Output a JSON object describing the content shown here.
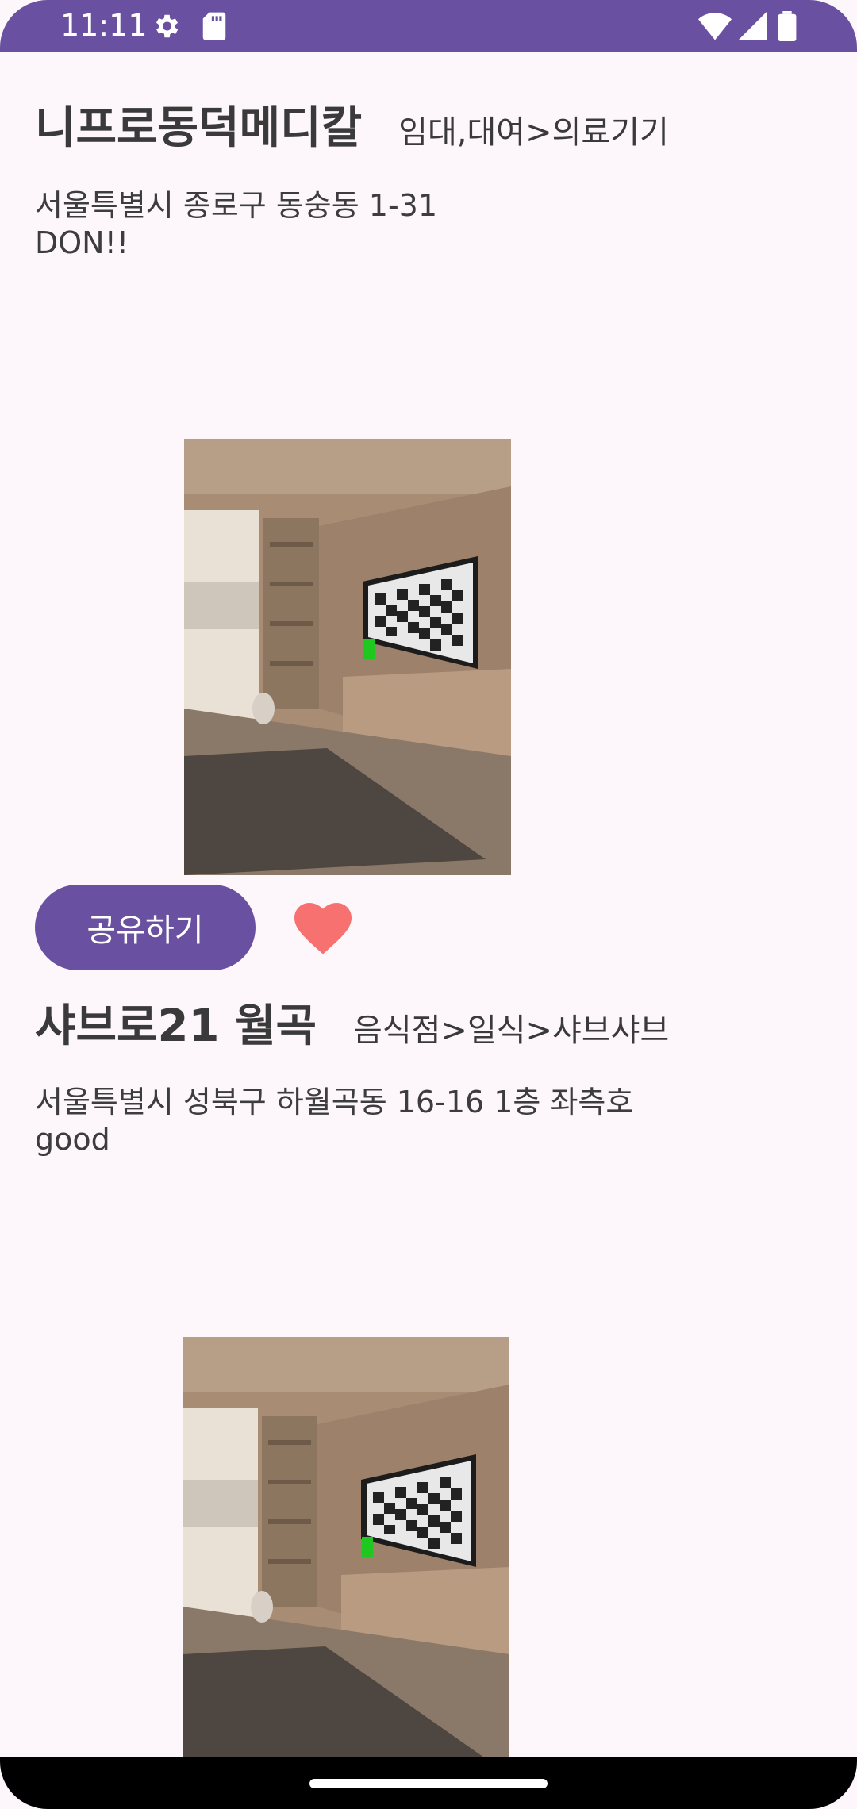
{
  "status_bar": {
    "time": "11:11",
    "icons": [
      "settings-icon",
      "sd-card-icon",
      "wifi-icon",
      "signal-icon",
      "battery-icon"
    ]
  },
  "items": [
    {
      "name": "니프로동덕메디칼",
      "category": "임대,대여>의료기기",
      "address": "서울특별시 종로구 동숭동 1-31",
      "memo": "DON!!",
      "share_label": "공유하기",
      "favorite_icon": "heart-icon"
    },
    {
      "name": "샤브로21 월곡",
      "category": "음식점>일식>샤브샤브",
      "address": "서울특별시 성북구 하월곡동 16-16 1층 좌측호",
      "memo": "good"
    }
  ],
  "colors": {
    "accent": "#6950a1",
    "heart": "#f87171",
    "background": "#fdf7fb"
  }
}
